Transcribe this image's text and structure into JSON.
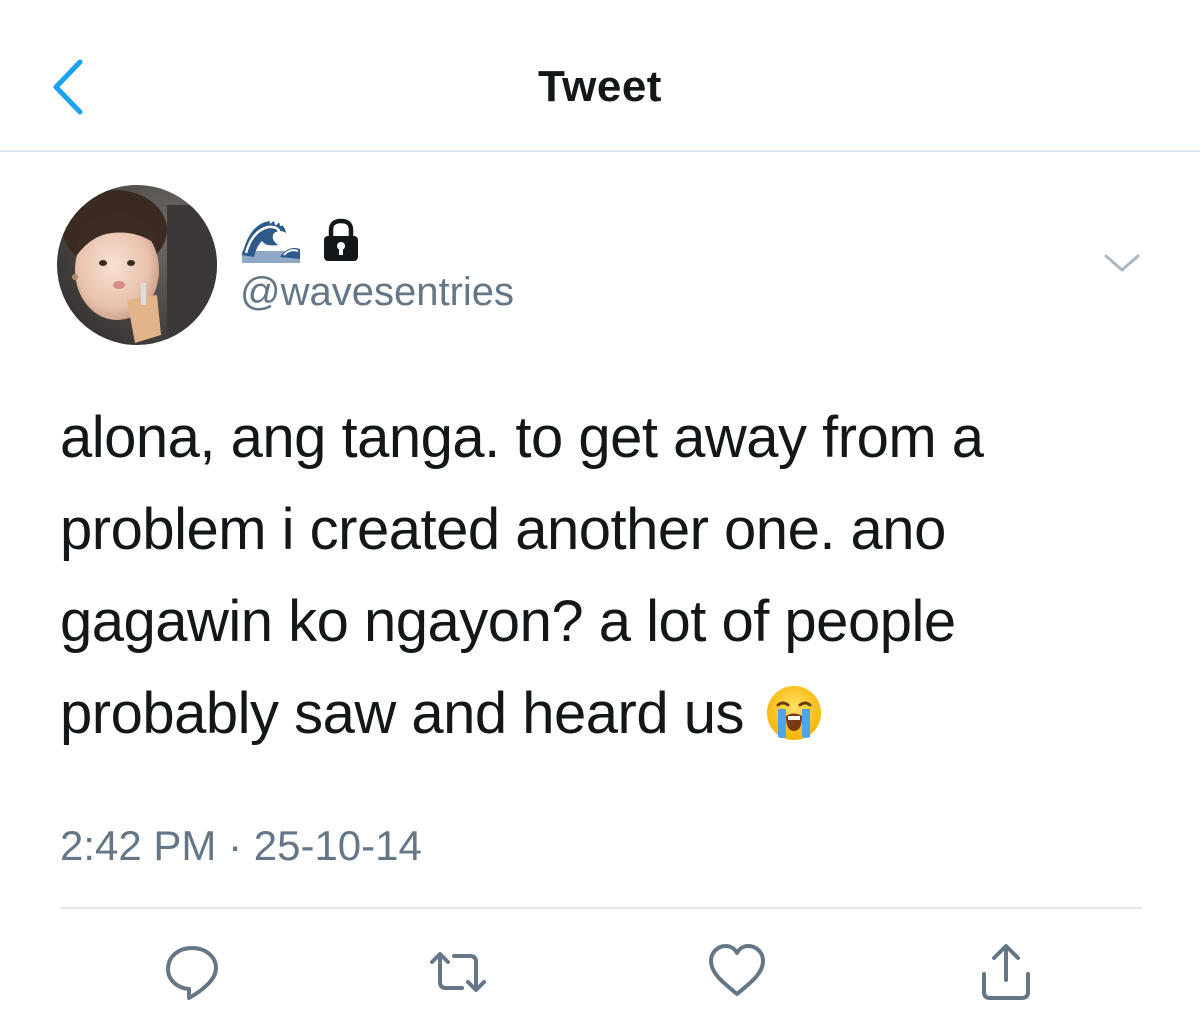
{
  "header": {
    "title": "Tweet",
    "back_icon": "chevron-left-icon",
    "accent_color": "#1da1f2"
  },
  "author": {
    "display_name_icons": [
      "water-wave-emoji-icon",
      "lock-icon"
    ],
    "handle": "@wavesentries",
    "menu_icon": "chevron-down-icon"
  },
  "tweet": {
    "lines": [
      "alona, ang tanga. to get away from a",
      "problem i created another one. ano",
      "gagawin ko ngayon? a lot of people",
      "probably saw and heard us"
    ],
    "trailing_emoji": "loudly-crying-face-emoji-icon",
    "timestamp": "2:42 PM · 25-10-14"
  },
  "actions": [
    {
      "name": "reply-icon"
    },
    {
      "name": "retweet-icon"
    },
    {
      "name": "like-icon"
    },
    {
      "name": "share-icon"
    }
  ],
  "colors": {
    "text": "#14171a",
    "secondary": "#657786",
    "divider": "#e1e8ed"
  }
}
